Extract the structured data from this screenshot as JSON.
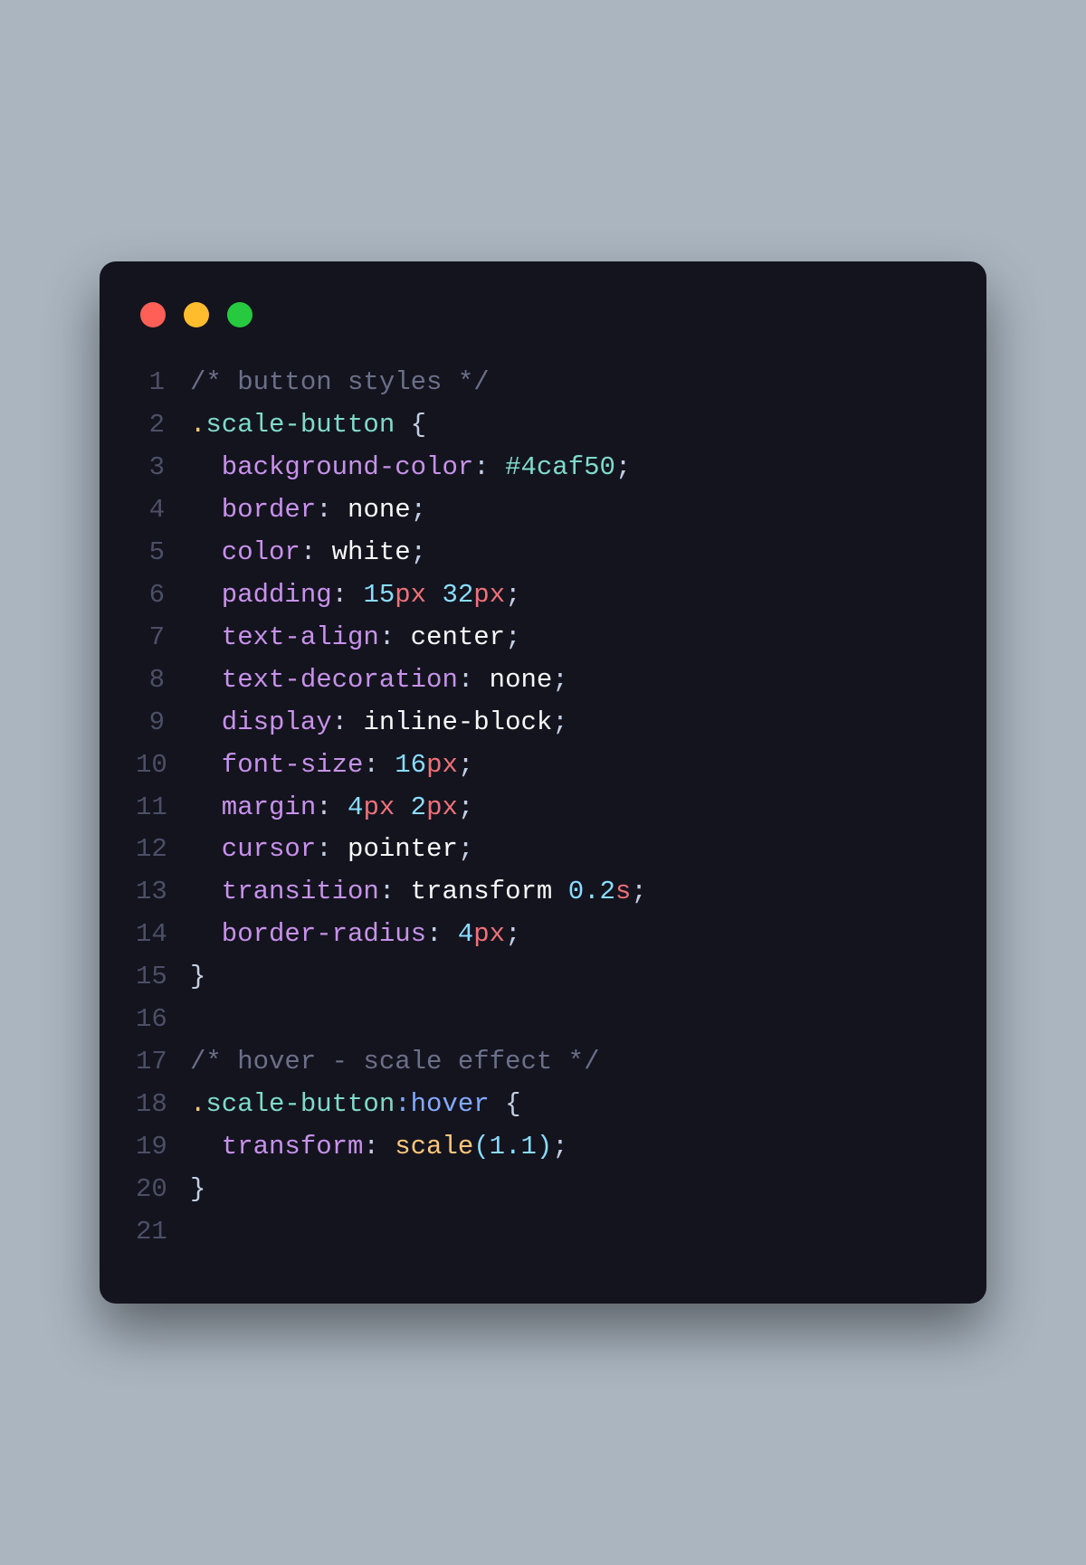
{
  "window": {
    "traffic": [
      "close",
      "minimize",
      "zoom"
    ]
  },
  "code": {
    "lines": [
      {
        "n": "1",
        "tokens": [
          {
            "cls": "c-comment",
            "t": "/* button styles */"
          }
        ]
      },
      {
        "n": "2",
        "tokens": [
          {
            "cls": "c-selector",
            "t": "."
          },
          {
            "cls": "c-class",
            "t": "scale-button"
          },
          {
            "cls": "c-brace",
            "t": " {"
          }
        ]
      },
      {
        "n": "3",
        "tokens": [
          {
            "cls": "c-prop",
            "t": "  background-color"
          },
          {
            "cls": "c-punct",
            "t": ": "
          },
          {
            "cls": "c-hex",
            "t": "#4caf50"
          },
          {
            "cls": "c-punct",
            "t": ";"
          }
        ]
      },
      {
        "n": "4",
        "tokens": [
          {
            "cls": "c-prop",
            "t": "  border"
          },
          {
            "cls": "c-punct",
            "t": ": "
          },
          {
            "cls": "c-value",
            "t": "none"
          },
          {
            "cls": "c-punct",
            "t": ";"
          }
        ]
      },
      {
        "n": "5",
        "tokens": [
          {
            "cls": "c-prop",
            "t": "  color"
          },
          {
            "cls": "c-punct",
            "t": ": "
          },
          {
            "cls": "c-value",
            "t": "white"
          },
          {
            "cls": "c-punct",
            "t": ";"
          }
        ]
      },
      {
        "n": "6",
        "tokens": [
          {
            "cls": "c-prop",
            "t": "  padding"
          },
          {
            "cls": "c-punct",
            "t": ": "
          },
          {
            "cls": "c-num",
            "t": "15"
          },
          {
            "cls": "c-unit",
            "t": "px"
          },
          {
            "cls": "c-value",
            "t": " "
          },
          {
            "cls": "c-num",
            "t": "32"
          },
          {
            "cls": "c-unit",
            "t": "px"
          },
          {
            "cls": "c-punct",
            "t": ";"
          }
        ]
      },
      {
        "n": "7",
        "tokens": [
          {
            "cls": "c-prop",
            "t": "  text-align"
          },
          {
            "cls": "c-punct",
            "t": ": "
          },
          {
            "cls": "c-value",
            "t": "center"
          },
          {
            "cls": "c-punct",
            "t": ";"
          }
        ]
      },
      {
        "n": "8",
        "tokens": [
          {
            "cls": "c-prop",
            "t": "  text-decoration"
          },
          {
            "cls": "c-punct",
            "t": ": "
          },
          {
            "cls": "c-value",
            "t": "none"
          },
          {
            "cls": "c-punct",
            "t": ";"
          }
        ]
      },
      {
        "n": "9",
        "tokens": [
          {
            "cls": "c-prop",
            "t": "  display"
          },
          {
            "cls": "c-punct",
            "t": ": "
          },
          {
            "cls": "c-value",
            "t": "inline-block"
          },
          {
            "cls": "c-punct",
            "t": ";"
          }
        ]
      },
      {
        "n": "10",
        "tokens": [
          {
            "cls": "c-prop",
            "t": "  font-size"
          },
          {
            "cls": "c-punct",
            "t": ": "
          },
          {
            "cls": "c-num",
            "t": "16"
          },
          {
            "cls": "c-unit",
            "t": "px"
          },
          {
            "cls": "c-punct",
            "t": ";"
          }
        ]
      },
      {
        "n": "11",
        "tokens": [
          {
            "cls": "c-prop",
            "t": "  margin"
          },
          {
            "cls": "c-punct",
            "t": ": "
          },
          {
            "cls": "c-num",
            "t": "4"
          },
          {
            "cls": "c-unit",
            "t": "px"
          },
          {
            "cls": "c-value",
            "t": " "
          },
          {
            "cls": "c-num",
            "t": "2"
          },
          {
            "cls": "c-unit",
            "t": "px"
          },
          {
            "cls": "c-punct",
            "t": ";"
          }
        ]
      },
      {
        "n": "12",
        "tokens": [
          {
            "cls": "c-prop",
            "t": "  cursor"
          },
          {
            "cls": "c-punct",
            "t": ": "
          },
          {
            "cls": "c-value",
            "t": "pointer"
          },
          {
            "cls": "c-punct",
            "t": ";"
          }
        ]
      },
      {
        "n": "13",
        "tokens": [
          {
            "cls": "c-prop",
            "t": "  transition"
          },
          {
            "cls": "c-punct",
            "t": ": "
          },
          {
            "cls": "c-value",
            "t": "transform "
          },
          {
            "cls": "c-num",
            "t": "0.2"
          },
          {
            "cls": "c-unit",
            "t": "s"
          },
          {
            "cls": "c-punct",
            "t": ";"
          }
        ]
      },
      {
        "n": "14",
        "tokens": [
          {
            "cls": "c-prop",
            "t": "  border-radius"
          },
          {
            "cls": "c-punct",
            "t": ": "
          },
          {
            "cls": "c-num",
            "t": "4"
          },
          {
            "cls": "c-unit",
            "t": "px"
          },
          {
            "cls": "c-punct",
            "t": ";"
          }
        ]
      },
      {
        "n": "15",
        "tokens": [
          {
            "cls": "c-brace",
            "t": "}"
          }
        ]
      },
      {
        "n": "16",
        "tokens": [
          {
            "cls": "c-value",
            "t": ""
          }
        ]
      },
      {
        "n": "17",
        "tokens": [
          {
            "cls": "c-comment",
            "t": "/* hover - scale effect */"
          }
        ]
      },
      {
        "n": "18",
        "tokens": [
          {
            "cls": "c-selector",
            "t": "."
          },
          {
            "cls": "c-class",
            "t": "scale-button"
          },
          {
            "cls": "c-pseudo",
            "t": ":hover"
          },
          {
            "cls": "c-brace",
            "t": " {"
          }
        ]
      },
      {
        "n": "19",
        "tokens": [
          {
            "cls": "c-prop",
            "t": "  transform"
          },
          {
            "cls": "c-punct",
            "t": ": "
          },
          {
            "cls": "c-func",
            "t": "scale"
          },
          {
            "cls": "c-paren",
            "t": "("
          },
          {
            "cls": "c-num",
            "t": "1.1"
          },
          {
            "cls": "c-paren",
            "t": ")"
          },
          {
            "cls": "c-punct",
            "t": ";"
          }
        ]
      },
      {
        "n": "20",
        "tokens": [
          {
            "cls": "c-brace",
            "t": "}"
          }
        ]
      },
      {
        "n": "21",
        "tokens": [
          {
            "cls": "c-value",
            "t": ""
          }
        ]
      }
    ]
  }
}
